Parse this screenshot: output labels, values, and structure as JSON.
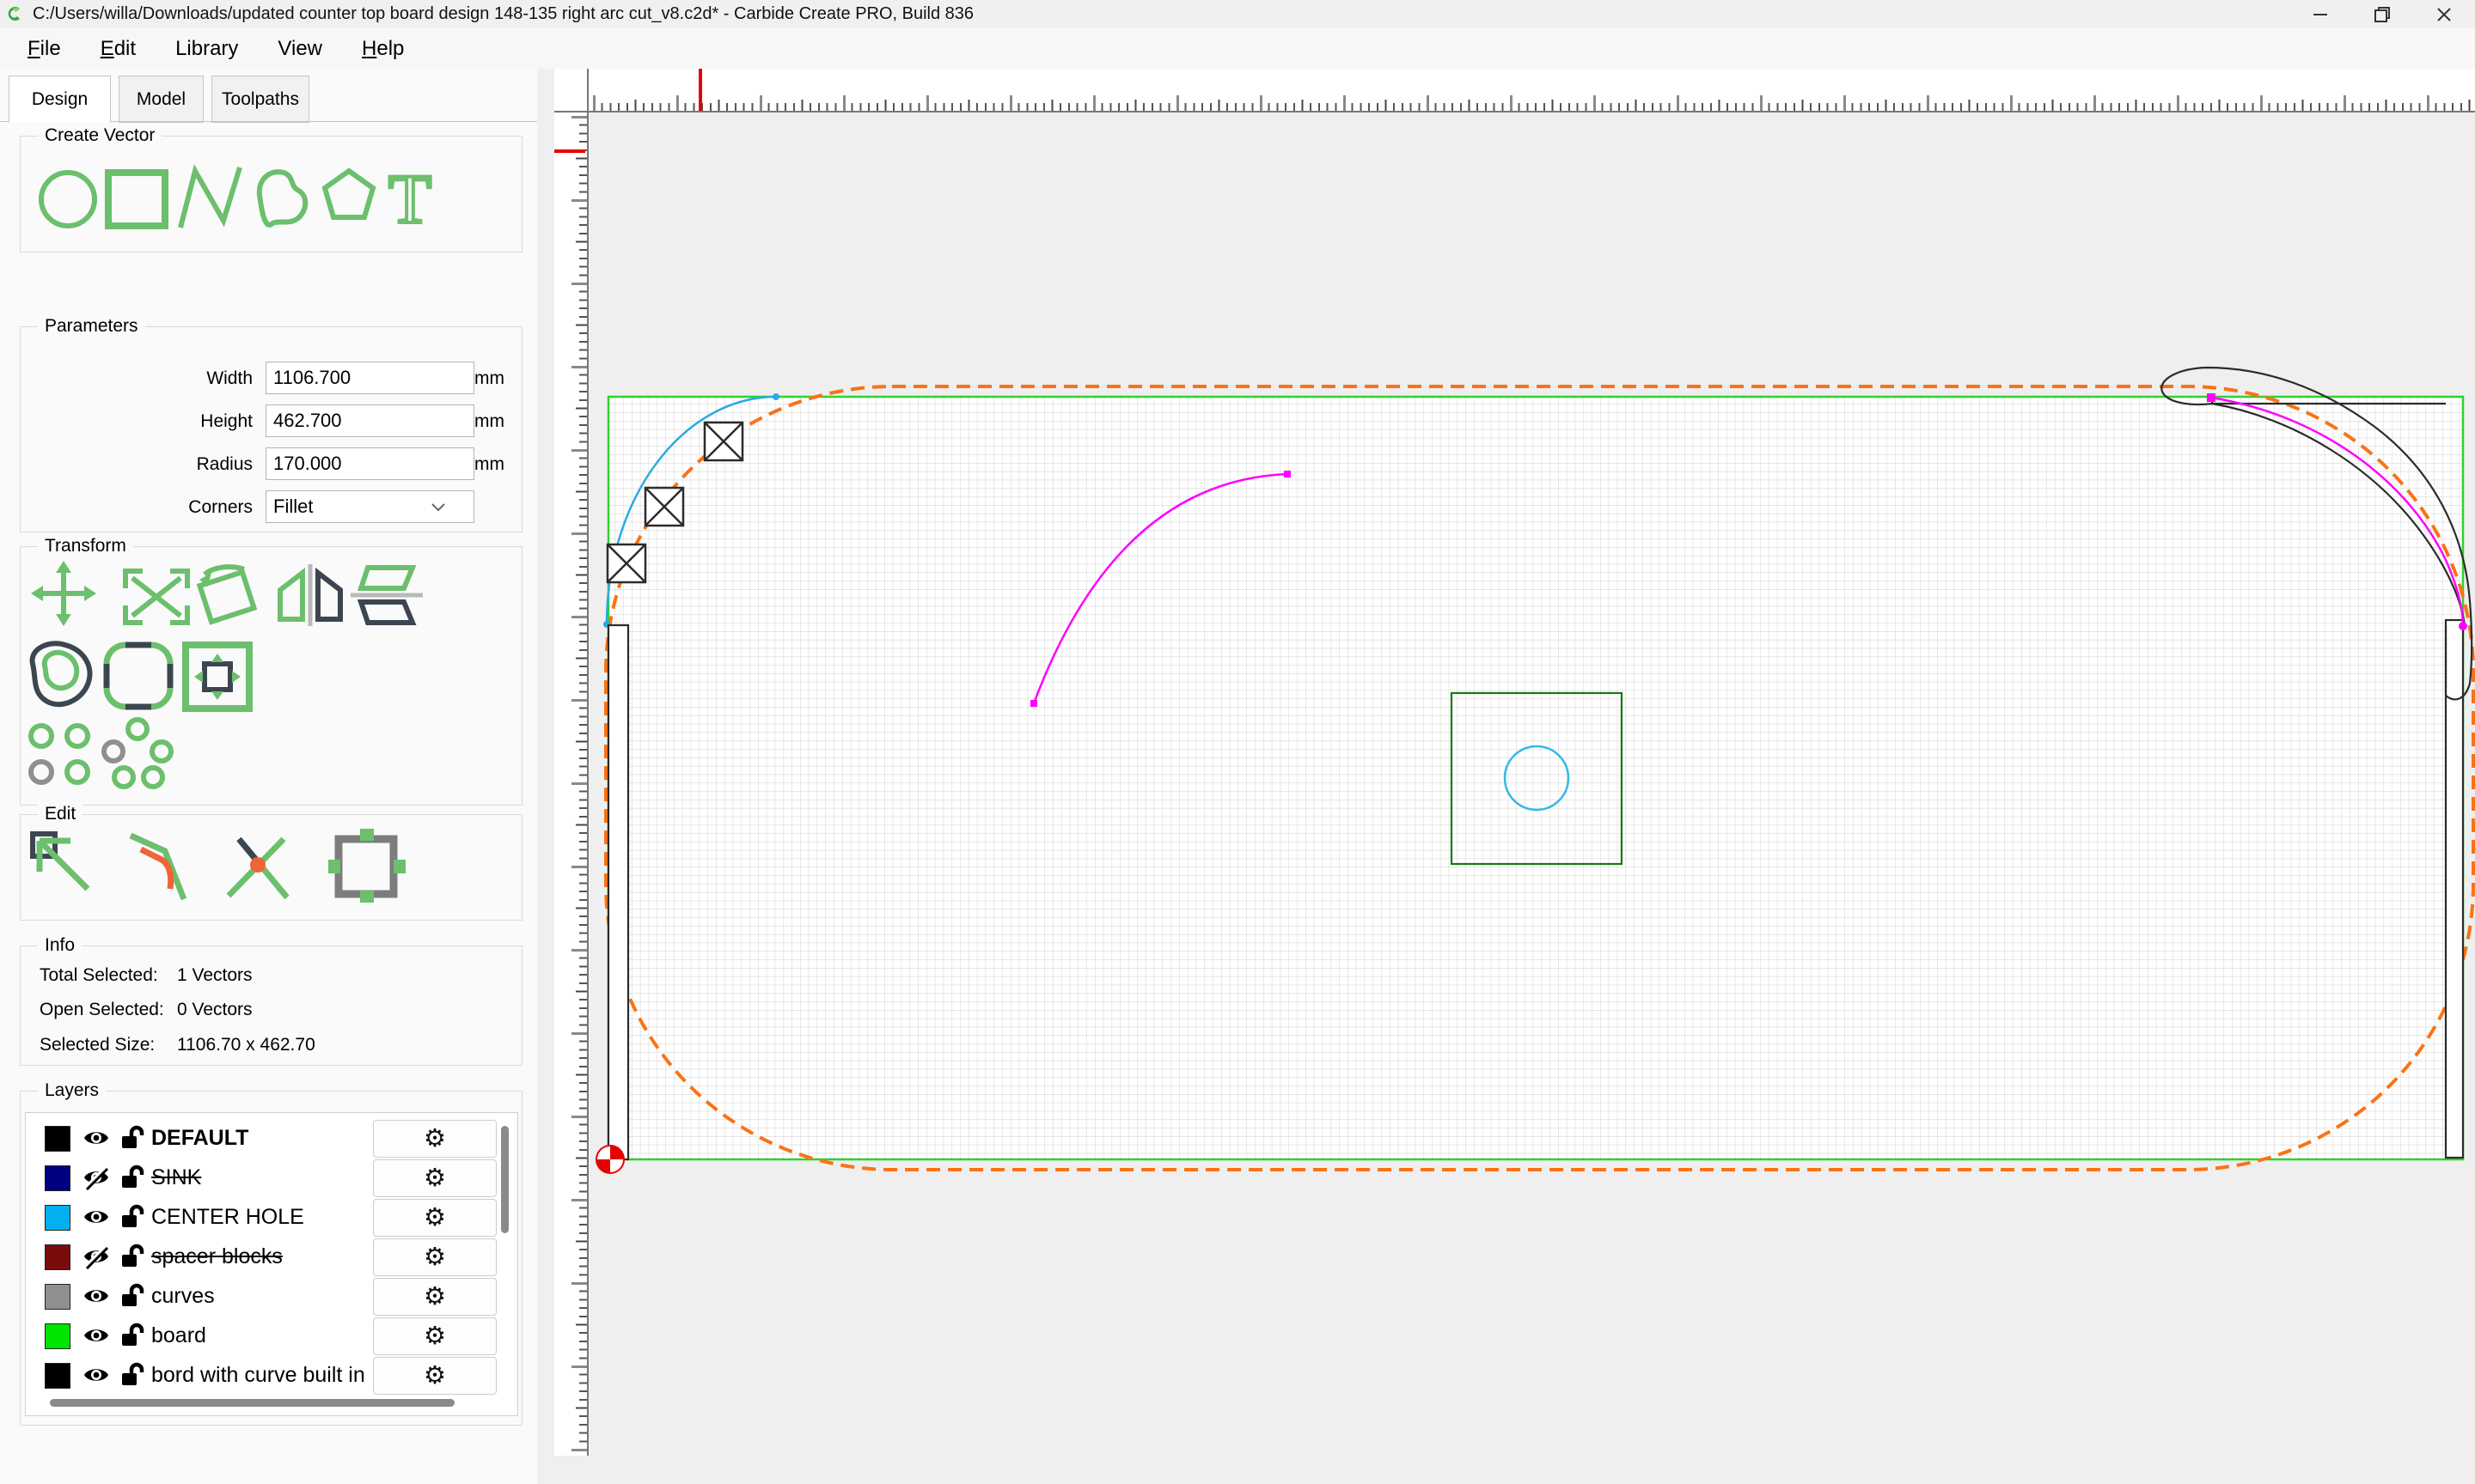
{
  "window": {
    "title": "C:/Users/willa/Downloads/updated counter top board design 148-135 right arc cut_v8.c2d* - Carbide Create PRO, Build 836",
    "controls": {
      "minimize": "minimize",
      "restore": "restore",
      "close": "close"
    }
  },
  "menu": {
    "items": [
      {
        "label": "File",
        "underline": 0
      },
      {
        "label": "Edit",
        "underline": 0
      },
      {
        "label": "Library",
        "underline": -1
      },
      {
        "label": "View",
        "underline": -1
      },
      {
        "label": "Help",
        "underline": 0
      }
    ]
  },
  "tabs": [
    {
      "label": "Design",
      "active": true
    },
    {
      "label": "Model",
      "active": false
    },
    {
      "label": "Toolpaths",
      "active": false
    }
  ],
  "create_vector": {
    "label": "Create Vector",
    "tools": [
      "circle-tool",
      "rectangle-tool",
      "polyline-tool",
      "curve-tool",
      "polygon-tool",
      "text-tool"
    ]
  },
  "parameters": {
    "label": "Parameters",
    "fields": [
      {
        "name": "Width",
        "value": "1106.700",
        "unit": "mm"
      },
      {
        "name": "Height",
        "value": "462.700",
        "unit": "mm"
      },
      {
        "name": "Radius",
        "value": "170.000",
        "unit": "mm"
      }
    ],
    "corners": {
      "name": "Corners",
      "value": "Fillet"
    }
  },
  "transform": {
    "label": "Transform",
    "tools_row1": [
      "move-tool",
      "scale-tool",
      "rotate-tool",
      "mirror-horizontal-tool",
      "mirror-vertical-tool"
    ],
    "tools_row2": [
      "offset-tool",
      "round-corners-tool",
      "align-center-tool"
    ],
    "tools_row3": [
      "grid-array-tool",
      "circular-array-tool"
    ]
  },
  "edit": {
    "label": "Edit",
    "tools": [
      "node-edit-tool",
      "trim-tool",
      "break-intersection-tool",
      "resize-tool"
    ]
  },
  "info": {
    "label": "Info",
    "rows": [
      {
        "name": "Total Selected:",
        "value": "1 Vectors"
      },
      {
        "name": "Open Selected:",
        "value": "0 Vectors"
      },
      {
        "name": "Selected Size:",
        "value": "1106.70 x 462.70"
      }
    ]
  },
  "layers": {
    "label": "Layers",
    "items": [
      {
        "name": "DEFAULT",
        "color": "#000000",
        "visible": true,
        "locked": false,
        "bold": true,
        "strike": false
      },
      {
        "name": "SINK",
        "color": "#000080",
        "visible": false,
        "locked": false,
        "bold": false,
        "strike": true
      },
      {
        "name": "CENTER HOLE",
        "color": "#00b0f0",
        "visible": true,
        "locked": false,
        "bold": false,
        "strike": false
      },
      {
        "name": "spacer blocks",
        "color": "#7b0c0c",
        "visible": false,
        "locked": false,
        "bold": false,
        "strike": true
      },
      {
        "name": "curves",
        "color": "#8f8f8f",
        "visible": true,
        "locked": false,
        "bold": false,
        "strike": false
      },
      {
        "name": "board",
        "color": "#00e400",
        "visible": true,
        "locked": false,
        "bold": false,
        "strike": false
      },
      {
        "name": "bord with curve built in",
        "color": "#000000",
        "visible": true,
        "locked": false,
        "bold": false,
        "strike": false
      }
    ]
  },
  "colors": {
    "tool-green": "#6cbf6c",
    "tool-dark": "#3c4650",
    "tool-orange": "#f06437",
    "marker-red": "#e80000",
    "board-green": "#2fd12f",
    "selection-orange": "#f97316",
    "arc-cyan": "#29abe2",
    "circle-cyan": "#35b8e8",
    "square-darkgreen": "#157815",
    "curve-magenta": "#ff00ff",
    "outline-black": "#2b2b2b",
    "grid-line": "#d8d8d8"
  }
}
